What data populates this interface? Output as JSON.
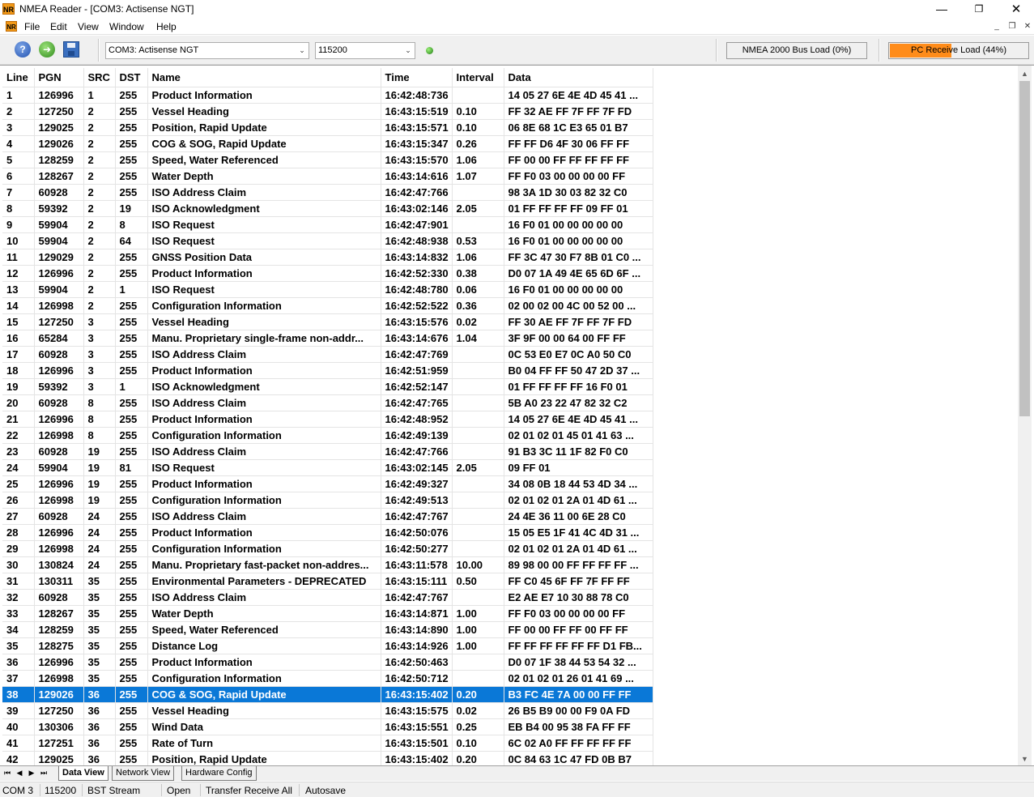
{
  "window": {
    "app_icon": "NR",
    "title": "NMEA Reader - [COM3: Actisense NGT]",
    "minimize_glyph": "—",
    "maximize_glyph": "❐",
    "close_glyph": "✕"
  },
  "menu": {
    "icon": "NR",
    "items": [
      "File",
      "Edit",
      "View",
      "Window",
      "Help"
    ],
    "mdi_min": "_",
    "mdi_restore": "❐",
    "mdi_close": "✕"
  },
  "toolbar": {
    "help_glyph": "?",
    "go_glyph": "➜",
    "port_value": "COM3: Actisense NGT",
    "baud_value": "115200",
    "combo_arrow": "⌄",
    "bus_load_label": "NMEA 2000 Bus Load (0%)",
    "bus_load_fraction": 0,
    "pc_load_label": "PC Receive Load (44%)",
    "pc_load_fraction": 0.44,
    "pc_load_color": "#ff8c1a"
  },
  "grid": {
    "columns": [
      "Line",
      "PGN",
      "SRC",
      "DST",
      "Name",
      "Time",
      "Interval",
      "Data"
    ],
    "selected_line": "38",
    "selection_color": "#0a78d7",
    "rows": [
      [
        "1",
        "126996",
        "1",
        "255",
        "Product Information",
        "16:42:48:736",
        "",
        "14 05 27 6E 4E 4D 45 41 ..."
      ],
      [
        "2",
        "127250",
        "2",
        "255",
        "Vessel Heading",
        "16:43:15:519",
        "0.10",
        "FF 32 AE FF 7F FF 7F FD"
      ],
      [
        "3",
        "129025",
        "2",
        "255",
        "Position, Rapid Update",
        "16:43:15:571",
        "0.10",
        "06 8E 68 1C E3 65 01 B7"
      ],
      [
        "4",
        "129026",
        "2",
        "255",
        "COG & SOG, Rapid Update",
        "16:43:15:347",
        "0.26",
        "FF FF D6 4F 30 06 FF FF"
      ],
      [
        "5",
        "128259",
        "2",
        "255",
        "Speed, Water Referenced",
        "16:43:15:570",
        "1.06",
        "FF 00 00 FF FF FF FF FF"
      ],
      [
        "6",
        "128267",
        "2",
        "255",
        "Water Depth",
        "16:43:14:616",
        "1.07",
        "FF F0 03 00 00 00 00 FF"
      ],
      [
        "7",
        "60928",
        "2",
        "255",
        "ISO Address Claim",
        "16:42:47:766",
        "",
        "98 3A 1D 30 03 82 32 C0"
      ],
      [
        "8",
        "59392",
        "2",
        "19",
        "ISO Acknowledgment",
        "16:43:02:146",
        "2.05",
        "01 FF FF FF FF 09 FF 01"
      ],
      [
        "9",
        "59904",
        "2",
        "8",
        "ISO Request",
        "16:42:47:901",
        "",
        "16 F0 01 00 00 00 00 00"
      ],
      [
        "10",
        "59904",
        "2",
        "64",
        "ISO Request",
        "16:42:48:938",
        "0.53",
        "16 F0 01 00 00 00 00 00"
      ],
      [
        "11",
        "129029",
        "2",
        "255",
        "GNSS Position Data",
        "16:43:14:832",
        "1.06",
        "FF 3C 47 30 F7 8B 01 C0 ..."
      ],
      [
        "12",
        "126996",
        "2",
        "255",
        "Product Information",
        "16:42:52:330",
        "0.38",
        "D0 07 1A 49 4E 65 6D 6F ..."
      ],
      [
        "13",
        "59904",
        "2",
        "1",
        "ISO Request",
        "16:42:48:780",
        "0.06",
        "16 F0 01 00 00 00 00 00"
      ],
      [
        "14",
        "126998",
        "2",
        "255",
        "Configuration Information",
        "16:42:52:522",
        "0.36",
        "02 00 02 00 4C 00 52 00 ..."
      ],
      [
        "15",
        "127250",
        "3",
        "255",
        "Vessel Heading",
        "16:43:15:576",
        "0.02",
        "FF 30 AE FF 7F FF 7F FD"
      ],
      [
        "16",
        "65284",
        "3",
        "255",
        "Manu. Proprietary single-frame non-addr...",
        "16:43:14:676",
        "1.04",
        "3F 9F 00 00 64 00 FF FF"
      ],
      [
        "17",
        "60928",
        "3",
        "255",
        "ISO Address Claim",
        "16:42:47:769",
        "",
        "0C 53 E0 E7 0C A0 50 C0"
      ],
      [
        "18",
        "126996",
        "3",
        "255",
        "Product Information",
        "16:42:51:959",
        "",
        "B0 04 FF FF 50 47 2D 37 ..."
      ],
      [
        "19",
        "59392",
        "3",
        "1",
        "ISO Acknowledgment",
        "16:42:52:147",
        "",
        "01 FF FF FF FF 16 F0 01"
      ],
      [
        "20",
        "60928",
        "8",
        "255",
        "ISO Address Claim",
        "16:42:47:765",
        "",
        "5B A0 23 22 47 82 32 C2"
      ],
      [
        "21",
        "126996",
        "8",
        "255",
        "Product Information",
        "16:42:48:952",
        "",
        "14 05 27 6E 4E 4D 45 41 ..."
      ],
      [
        "22",
        "126998",
        "8",
        "255",
        "Configuration Information",
        "16:42:49:139",
        "",
        "02 01 02 01 45 01 41 63 ..."
      ],
      [
        "23",
        "60928",
        "19",
        "255",
        "ISO Address Claim",
        "16:42:47:766",
        "",
        "91 B3 3C 11 1F 82 F0 C0"
      ],
      [
        "24",
        "59904",
        "19",
        "81",
        "ISO Request",
        "16:43:02:145",
        "2.05",
        "09 FF 01"
      ],
      [
        "25",
        "126996",
        "19",
        "255",
        "Product Information",
        "16:42:49:327",
        "",
        "34 08 0B 18 44 53 4D 34 ..."
      ],
      [
        "26",
        "126998",
        "19",
        "255",
        "Configuration Information",
        "16:42:49:513",
        "",
        "02 01 02 01 2A 01 4D 61 ..."
      ],
      [
        "27",
        "60928",
        "24",
        "255",
        "ISO Address Claim",
        "16:42:47:767",
        "",
        "24 4E 36 11 00 6E 28 C0"
      ],
      [
        "28",
        "126996",
        "24",
        "255",
        "Product Information",
        "16:42:50:076",
        "",
        "15 05 E5 1F 41 4C 4D 31 ..."
      ],
      [
        "29",
        "126998",
        "24",
        "255",
        "Configuration Information",
        "16:42:50:277",
        "",
        "02 01 02 01 2A 01 4D 61 ..."
      ],
      [
        "30",
        "130824",
        "24",
        "255",
        "Manu. Proprietary fast-packet non-addres...",
        "16:43:11:578",
        "10.00",
        "89 98 00 00 FF FF FF FF ..."
      ],
      [
        "31",
        "130311",
        "35",
        "255",
        "Environmental Parameters - DEPRECATED",
        "16:43:15:111",
        "0.50",
        "FF C0 45 6F FF 7F FF FF"
      ],
      [
        "32",
        "60928",
        "35",
        "255",
        "ISO Address Claim",
        "16:42:47:767",
        "",
        "E2 AE E7 10 30 88 78 C0"
      ],
      [
        "33",
        "128267",
        "35",
        "255",
        "Water Depth",
        "16:43:14:871",
        "1.00",
        "FF F0 03 00 00 00 00 FF"
      ],
      [
        "34",
        "128259",
        "35",
        "255",
        "Speed, Water Referenced",
        "16:43:14:890",
        "1.00",
        "FF 00 00 FF FF 00 FF FF"
      ],
      [
        "35",
        "128275",
        "35",
        "255",
        "Distance Log",
        "16:43:14:926",
        "1.00",
        "FF FF FF FF FF FF D1 FB..."
      ],
      [
        "36",
        "126996",
        "35",
        "255",
        "Product Information",
        "16:42:50:463",
        "",
        "D0 07 1F 38 44 53 54 32 ..."
      ],
      [
        "37",
        "126998",
        "35",
        "255",
        "Configuration Information",
        "16:42:50:712",
        "",
        "02 01 02 01 26 01 41 69 ..."
      ],
      [
        "38",
        "129026",
        "36",
        "255",
        "COG & SOG, Rapid Update",
        "16:43:15:402",
        "0.20",
        "B3 FC 4E 7A 00 00 FF FF"
      ],
      [
        "39",
        "127250",
        "36",
        "255",
        "Vessel Heading",
        "16:43:15:575",
        "0.02",
        "26 B5 B9 00 00 F9 0A FD"
      ],
      [
        "40",
        "130306",
        "36",
        "255",
        "Wind Data",
        "16:43:15:551",
        "0.25",
        "EB B4 00 95 38 FA FF FF"
      ],
      [
        "41",
        "127251",
        "36",
        "255",
        "Rate of Turn",
        "16:43:15:501",
        "0.10",
        "6C 02 A0 FF FF FF FF FF"
      ],
      [
        "42",
        "129025",
        "36",
        "255",
        "Position, Rapid Update",
        "16:43:15:402",
        "0.20",
        "0C 84 63 1C 47 FD 0B B7"
      ]
    ]
  },
  "scrollbar": {
    "up_glyph": "▲",
    "down_glyph": "▼"
  },
  "tabs": {
    "nav": [
      "⏮",
      "◀",
      "▶",
      "⏭"
    ],
    "items": [
      "Data View",
      "Network View",
      "Hardware Config"
    ],
    "active": "Data View"
  },
  "status": {
    "items": [
      "COM 3",
      "115200",
      "BST Stream",
      "Open",
      "Transfer Receive All",
      "Autosave"
    ]
  }
}
